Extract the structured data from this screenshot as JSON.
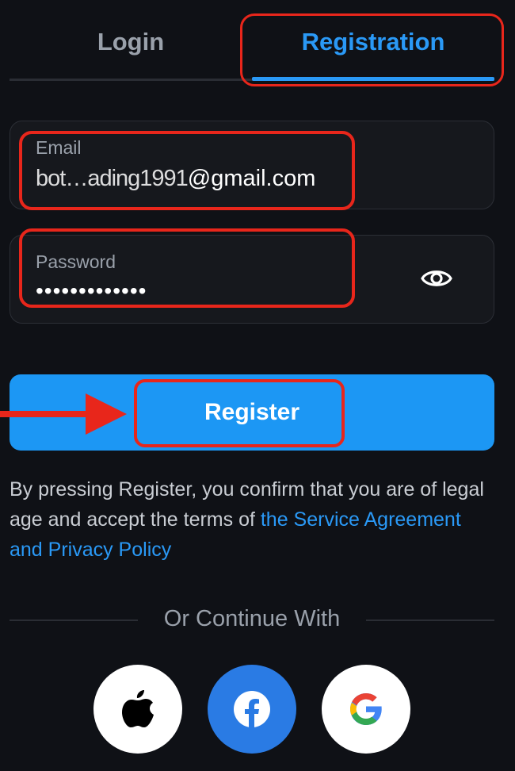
{
  "tabs": {
    "login_label": "Login",
    "registration_label": "Registration"
  },
  "form": {
    "email": {
      "label": "Email",
      "value_visible": "@gmail.com",
      "value_obscured": "bot…ading1991"
    },
    "password": {
      "label": "Password",
      "value": "•••••••••••••"
    },
    "register_label": "Register"
  },
  "terms": {
    "text": "By pressing Register, you confirm that you are of legal age and accept the terms of ",
    "link": "the Service Agreement and Privacy Policy"
  },
  "divider": {
    "text": "Or Continue With"
  },
  "social": {
    "apple_icon": "apple-icon",
    "facebook_icon": "facebook-icon",
    "google_icon": "google-icon"
  },
  "colors": {
    "accent": "#2a99f6",
    "button": "#1c97f4",
    "highlight": "#e8261b",
    "background": "#0f1116"
  }
}
